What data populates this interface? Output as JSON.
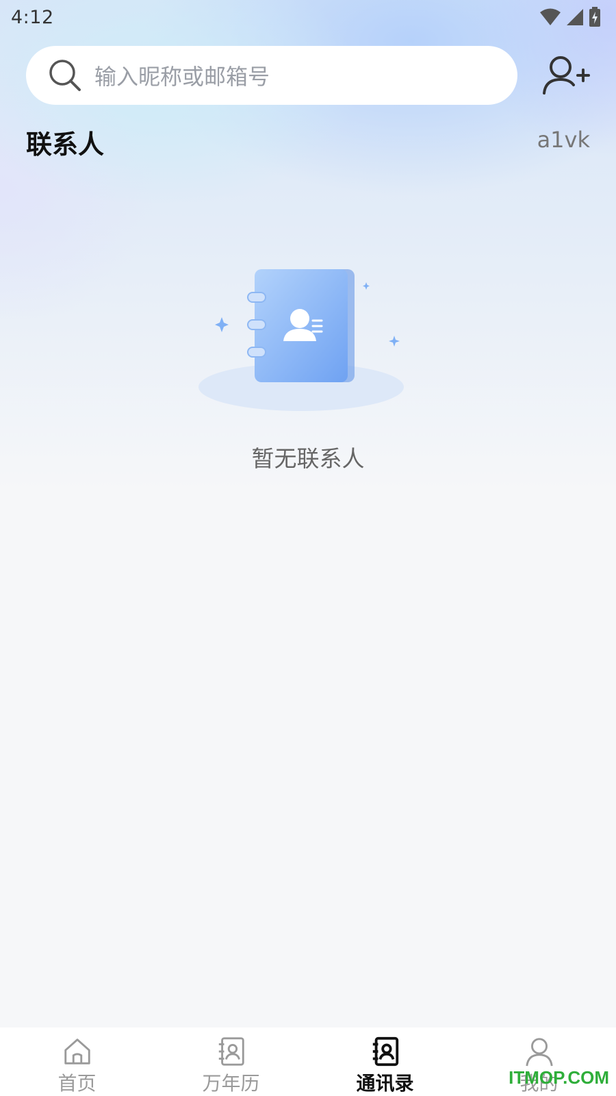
{
  "status_bar": {
    "time": "4:12"
  },
  "search": {
    "placeholder": "输入昵称或邮箱号"
  },
  "section": {
    "title": "联系人",
    "user_code": "a1vk"
  },
  "empty_state": {
    "text": "暂无联系人"
  },
  "bottom_nav": {
    "items": [
      {
        "label": "首页",
        "icon": "home-icon",
        "active": false
      },
      {
        "label": "万年历",
        "icon": "calendar-book-icon",
        "active": false
      },
      {
        "label": "通讯录",
        "icon": "contacts-icon",
        "active": true
      },
      {
        "label": "我的",
        "icon": "user-icon",
        "active": false
      }
    ]
  },
  "watermark": "ITMOP.COM",
  "colors": {
    "accent_blue": "#7fb0f5",
    "active_nav": "#111111",
    "inactive_nav": "#9a9a9a"
  }
}
